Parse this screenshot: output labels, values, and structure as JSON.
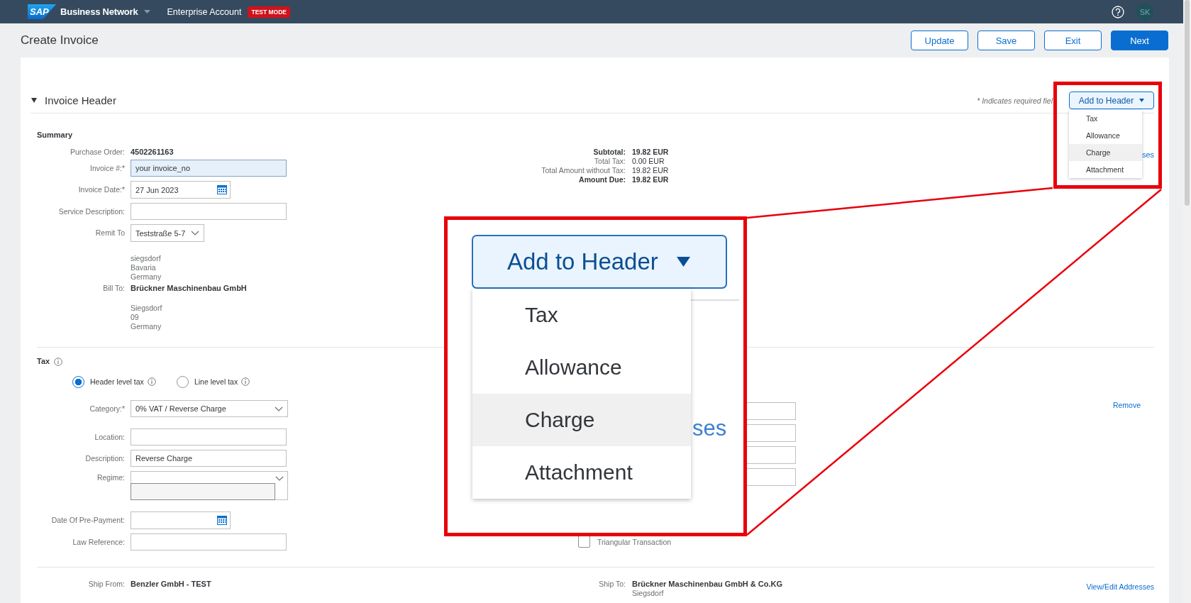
{
  "shell": {
    "logo": "SAP",
    "product": "Business Network",
    "account": "Enterprise Account",
    "badge": "TEST MODE",
    "avatar": "SK"
  },
  "page": {
    "title": "Create Invoice",
    "actions": [
      {
        "label": "Update",
        "primary": false
      },
      {
        "label": "Save",
        "primary": false
      },
      {
        "label": "Exit",
        "primary": false
      },
      {
        "label": "Next",
        "primary": true
      }
    ]
  },
  "invoice_header": {
    "title": "Invoice Header",
    "expanded": true,
    "required_note": "* Indicates required fiel",
    "add_menu": {
      "label": "Add to Header",
      "expanded": true,
      "items": [
        {
          "label": "Tax",
          "highlighted": false
        },
        {
          "label": "Allowance",
          "highlighted": false
        },
        {
          "label": "Charge",
          "highlighted": true
        },
        {
          "label": "Attachment",
          "highlighted": false
        }
      ]
    },
    "link_fragment": "ses"
  },
  "summary": {
    "title": "Summary",
    "fields": [
      {
        "label": "Purchase Order:",
        "kind": "text",
        "value": "4502261163"
      },
      {
        "label": "Invoice #:*",
        "kind": "input",
        "value": "your invoice_no",
        "focused": true
      },
      {
        "label": "Invoice Date:*",
        "kind": "date",
        "value": "27 Jun 2023",
        "focused": false
      },
      {
        "label": "Service Description:",
        "kind": "input",
        "focused": false
      },
      {
        "label": "Remit To",
        "kind": "select",
        "value": "Teststraße 5-7",
        "focused": false
      }
    ],
    "remit_address": [
      "siegsdorf",
      "Bavaria",
      "Germany"
    ],
    "bill_to": {
      "label": "Bill To:",
      "name": "Brückner Maschinenbau GmbH",
      "lines": [
        "Siegsdorf",
        "09",
        "Germany"
      ]
    },
    "totals": [
      {
        "label": "Subtotal:",
        "value": "19.82 EUR",
        "strong": true
      },
      {
        "label": "Total Tax:",
        "value": "0.00 EUR",
        "strong": false
      },
      {
        "label": "Total Amount without Tax:",
        "value": "19.82 EUR",
        "strong": false
      },
      {
        "label": "Amount Due:",
        "value": "19.82 EUR",
        "strong": true
      }
    ]
  },
  "tax": {
    "title": "Tax",
    "levels": [
      {
        "label": "Header level tax",
        "selected": true
      },
      {
        "label": "Line level tax",
        "selected": false
      }
    ],
    "fields": [
      {
        "label": "Category:*",
        "kind": "select",
        "value": "0% VAT / Reverse Charge"
      },
      {
        "label": "Location:",
        "kind": "input"
      },
      {
        "label": "Description:",
        "kind": "input",
        "value": "Reverse Charge"
      },
      {
        "label": "Regime:",
        "kind": "combo"
      },
      {
        "label": "Date Of Pre-Payment:",
        "kind": "date"
      },
      {
        "label": "Law Reference:",
        "kind": "input"
      }
    ],
    "remove": "Remove",
    "triangular": {
      "label": "Triangular Transaction",
      "checked": false
    }
  },
  "shipping": {
    "from": {
      "label": "Ship From:",
      "lines": [
        "Benzler GmbH - TEST"
      ]
    },
    "to": {
      "label": "Ship To:",
      "lines": [
        "Brückner Maschinenbau GmbH & Co.KG",
        "Siegsdorf"
      ]
    },
    "link": "View/Edit Addresses"
  },
  "callout": {
    "button": "Add to Header",
    "items": [
      {
        "label": "Tax",
        "highlighted": false
      },
      {
        "label": "Allowance",
        "highlighted": false
      },
      {
        "label": "Charge",
        "highlighted": true
      },
      {
        "label": "Attachment",
        "highlighted": false
      }
    ],
    "link_fragment": "ses"
  }
}
